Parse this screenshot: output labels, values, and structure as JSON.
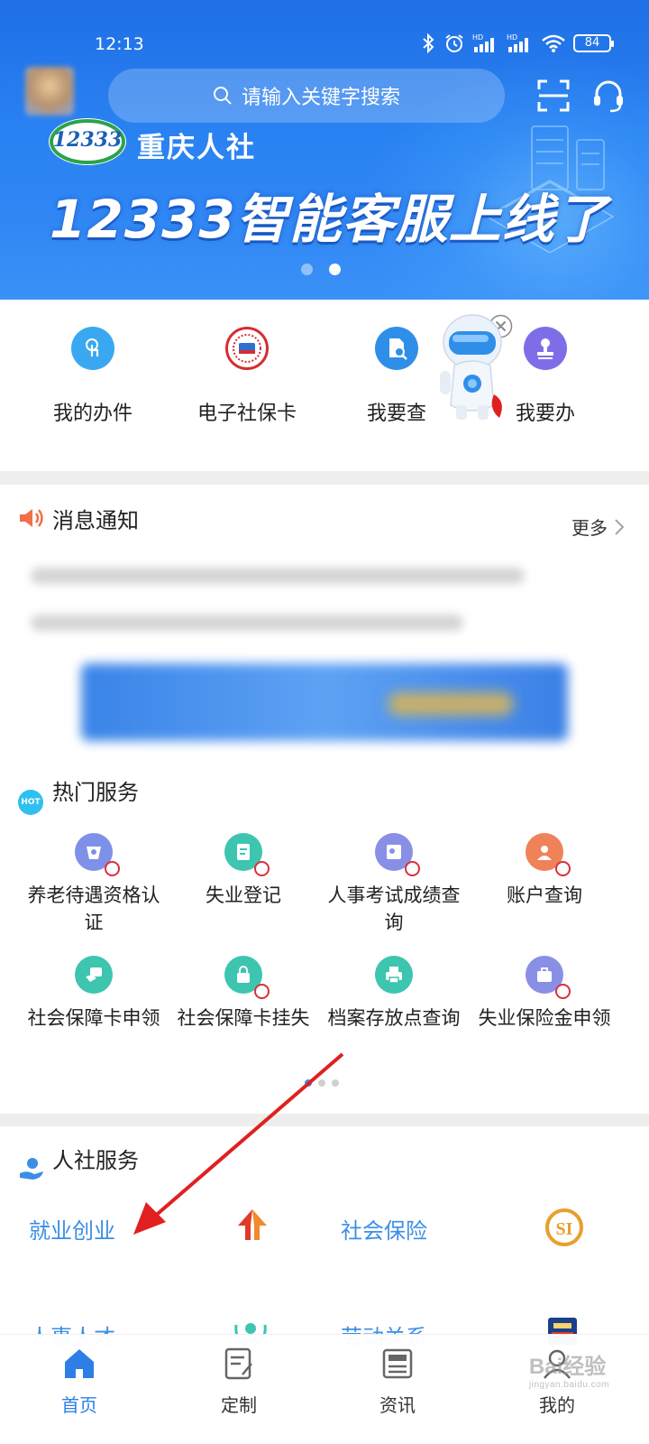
{
  "status_bar": {
    "time": "12:13",
    "battery": "84"
  },
  "header": {
    "search_placeholder": "请输入关键字搜索",
    "brand_logo_text": "12333",
    "brand_name": "重庆人社",
    "banner_headline": "12333智能客服上线了",
    "banner_page": 2,
    "banner_page_count": 2
  },
  "quick_entries": [
    {
      "label": "我的办件",
      "icon": "touch-icon",
      "color": "#3aa8f0"
    },
    {
      "label": "电子社保卡",
      "icon": "social-security-card-seal-icon",
      "color": "#d42e34"
    },
    {
      "label": "我要查",
      "icon": "document-search-icon",
      "color": "#2f8fe8"
    },
    {
      "label": "我要办",
      "icon": "stamp-icon",
      "color": "#7d6ee8"
    }
  ],
  "notice": {
    "title": "消息通知",
    "more_label": "更多"
  },
  "hot_services": {
    "title": "热门服务",
    "badge": "HOT",
    "page": 1,
    "page_count": 3,
    "items": [
      {
        "label": "养老待遇资格认证",
        "icon": "pension-certification-icon",
        "color": "#7f90e8"
      },
      {
        "label": "失业登记",
        "icon": "registration-form-icon",
        "color": "#3dc5b0"
      },
      {
        "label": "人事考试成绩查询",
        "icon": "exam-score-icon",
        "color": "#8a8fe6"
      },
      {
        "label": "账户查询",
        "icon": "account-person-icon",
        "color": "#f0825a"
      },
      {
        "label": "社会保障卡申领",
        "icon": "card-apply-icon",
        "color": "#3dc5b0"
      },
      {
        "label": "社会保障卡挂失",
        "icon": "card-lock-icon",
        "color": "#3dc5b0"
      },
      {
        "label": "档案存放点查询",
        "icon": "archive-printer-icon",
        "color": "#3dc5b0"
      },
      {
        "label": "失业保险金申领",
        "icon": "insurance-bag-icon",
        "color": "#8a8fe6"
      }
    ]
  },
  "hr_services": {
    "title": "人社服务",
    "items": [
      {
        "label": "就业创业",
        "icon": "employment-logo-icon"
      },
      {
        "label": "社会保险",
        "icon": "social-insurance-logo-icon"
      },
      {
        "label": "人事人才",
        "icon": "talent-laurel-icon"
      },
      {
        "label": "劳动关系",
        "icon": "labor-inspection-badge-icon"
      }
    ]
  },
  "tabbar": {
    "items": [
      {
        "label": "首页",
        "icon": "home-icon",
        "active": true
      },
      {
        "label": "定制",
        "icon": "custom-document-icon",
        "active": false
      },
      {
        "label": "资讯",
        "icon": "news-icon",
        "active": false
      },
      {
        "label": "我的",
        "icon": "profile-icon",
        "active": false
      }
    ]
  },
  "watermark": {
    "text": "Bai经验",
    "subtext": "jingyan.baidu.com"
  },
  "colors": {
    "primary": "#2d7fe6",
    "link_blue": "#3b8ee4",
    "annotation_red": "#e02020"
  }
}
